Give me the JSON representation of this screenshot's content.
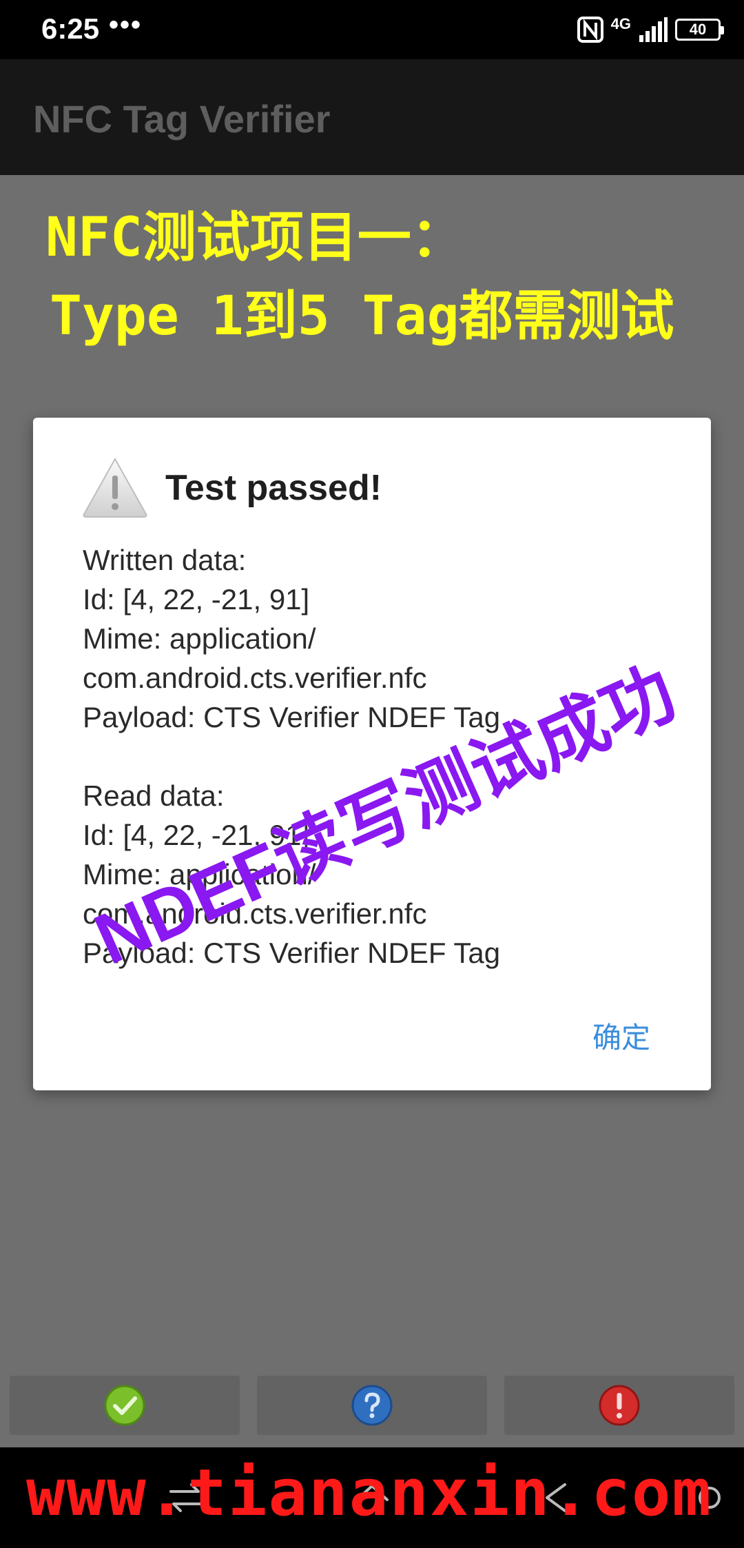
{
  "status_bar": {
    "time": "6:25",
    "dots": "•••",
    "network": "4G",
    "battery": "40"
  },
  "app_bar": {
    "title": "NFC Tag Verifier"
  },
  "captions": {
    "line1": "NFC测试项目一：",
    "line2": "Type 1到5 Tag都需测试"
  },
  "dialog": {
    "title": "Test passed!",
    "written": {
      "header": "Written data:",
      "id": "Id: [4, 22, -21, 91]",
      "mime1": "Mime: application/",
      "mime2": "com.android.cts.verifier.nfc",
      "payload": "Payload: CTS Verifier NDEF Tag"
    },
    "read": {
      "header": "Read data:",
      "id": "Id: [4, 22, -21, 91]",
      "mime1": "Mime: application/",
      "mime2": "com.android.cts.verifier.nfc",
      "payload": "Payload: CTS Verifier NDEF Tag"
    },
    "ok_label": "确定"
  },
  "overlay": {
    "text": "NDEF读写测试成功"
  },
  "buttons": {
    "pass_icon": "check-icon",
    "info_icon": "question-icon",
    "fail_icon": "exclamation-icon"
  },
  "watermark": {
    "text": "www.tiananxin.com"
  },
  "colors": {
    "caption": "#ffff1a",
    "overlay": "#8a18f0",
    "watermark": "#ff1a1a",
    "ok_button": "#3a8edb",
    "pass": "#7bbf2a",
    "info": "#2f6fc0",
    "fail": "#d42b2b"
  }
}
